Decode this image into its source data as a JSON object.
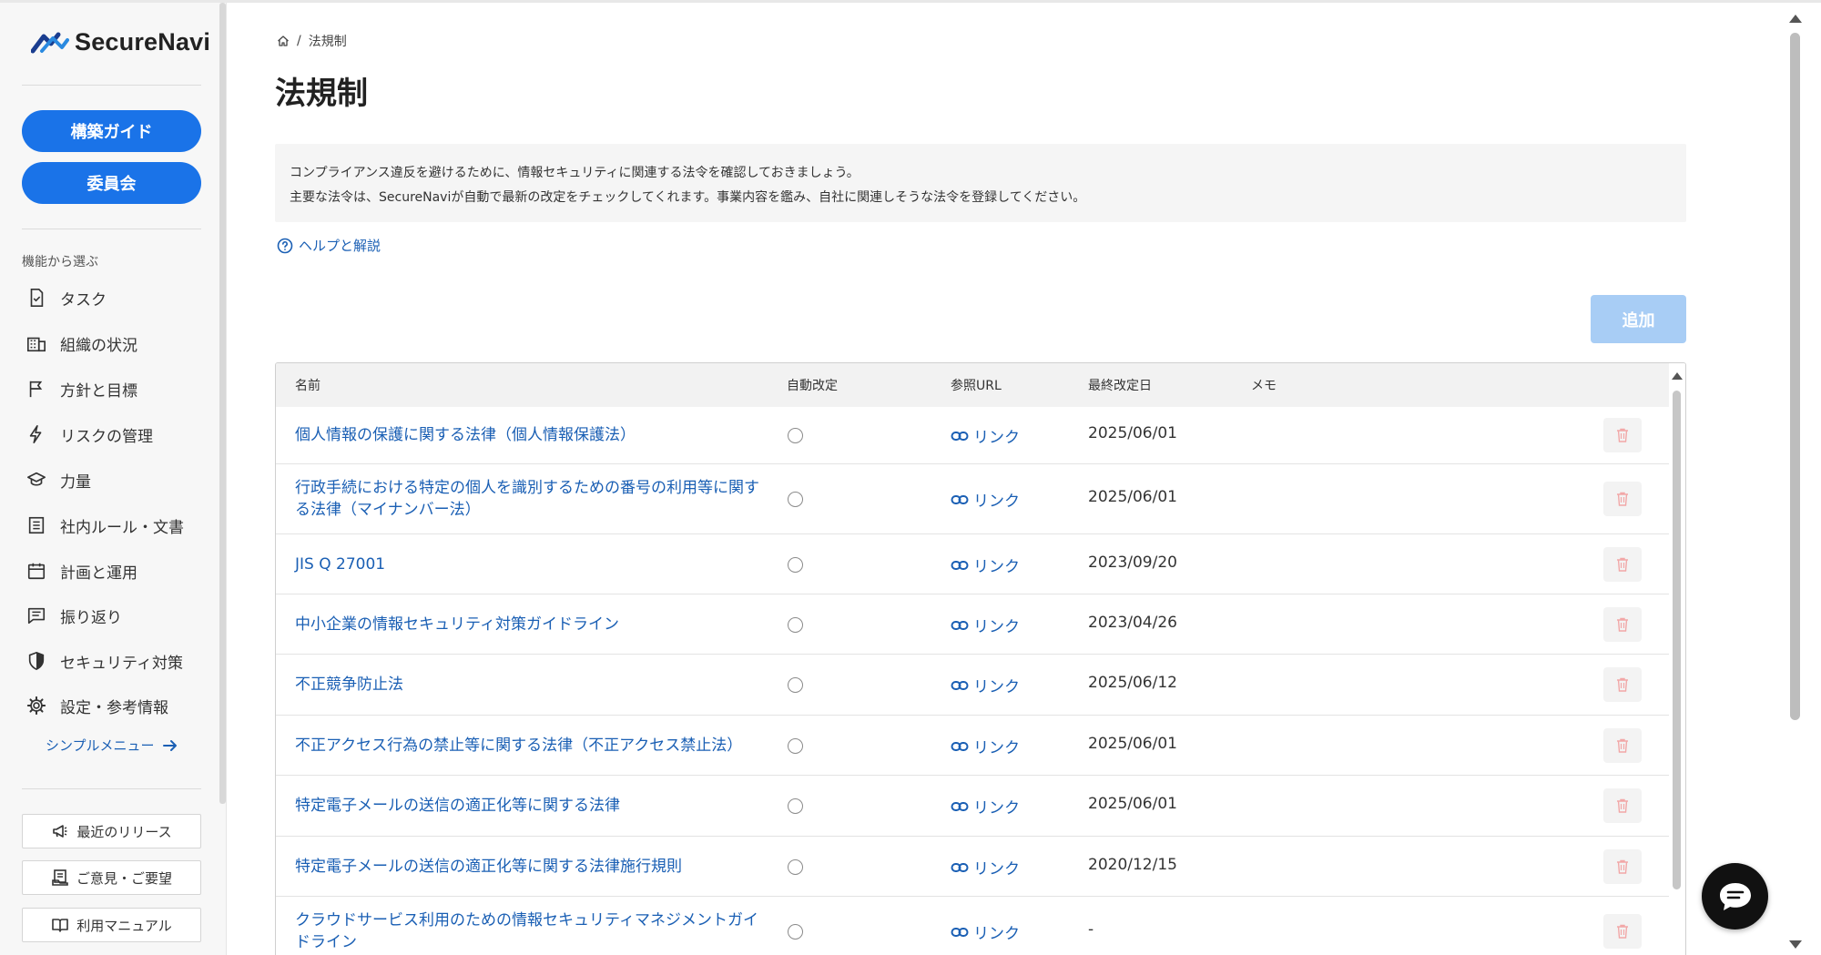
{
  "app": {
    "logo_text": "SecureNavi"
  },
  "sidebar": {
    "guide_button": "構築ガイド",
    "committee_button": "委員会",
    "section_label": "機能から選ぶ",
    "items": [
      {
        "label": "タスク",
        "icon": "task-check-icon"
      },
      {
        "label": "組織の状況",
        "icon": "building-icon"
      },
      {
        "label": "方針と目標",
        "icon": "flag-icon"
      },
      {
        "label": "リスクの管理",
        "icon": "bolt-icon"
      },
      {
        "label": "力量",
        "icon": "graduation-cap-icon"
      },
      {
        "label": "社内ルール・文書",
        "icon": "document-icon"
      },
      {
        "label": "計画と運用",
        "icon": "calendar-icon"
      },
      {
        "label": "振り返り",
        "icon": "notes-icon"
      },
      {
        "label": "セキュリティ対策",
        "icon": "shield-icon"
      },
      {
        "label": "設定・参考情報",
        "icon": "gear-icon"
      }
    ],
    "simple_menu": "シンプルメニュー",
    "footer": {
      "releases": "最近のリリース",
      "feedback": "ご意見・ご要望",
      "manual": "利用マニュアル"
    }
  },
  "breadcrumb": {
    "separator": "/",
    "current": "法規制"
  },
  "page": {
    "title": "法規制",
    "info_line1": "コンプライアンス違反を避けるために、情報セキュリティに関連する法令を確認しておきましょう。",
    "info_line2": "主要な法令は、SecureNaviが自動で最新の改定をチェックしてくれます。事業内容を鑑み、自社に関連しそうな法令を登録してください。",
    "help_link": "ヘルプと解説",
    "add_button": "追加"
  },
  "table": {
    "headers": {
      "name": "名前",
      "auto": "自動改定",
      "url": "参照URL",
      "date": "最終改定日",
      "memo": "メモ"
    },
    "link_label": "リンク",
    "rows": [
      {
        "name": "個人情報の保護に関する法律（個人情報保護法）",
        "date": "2025/06/01"
      },
      {
        "name": "行政手続における特定の個人を識別するための番号の利用等に関する法律（マイナンバー法）",
        "date": "2025/06/01"
      },
      {
        "name": "JIS Q 27001",
        "date": "2023/09/20"
      },
      {
        "name": "中小企業の情報セキュリティ対策ガイドライン",
        "date": "2023/04/26"
      },
      {
        "name": "不正競争防止法",
        "date": "2025/06/12"
      },
      {
        "name": "不正アクセス行為の禁止等に関する法律（不正アクセス禁止法）",
        "date": "2025/06/01"
      },
      {
        "name": "特定電子メールの送信の適正化等に関する法律",
        "date": "2025/06/01"
      },
      {
        "name": "特定電子メールの送信の適正化等に関する法律施行規則",
        "date": "2020/12/15"
      },
      {
        "name": "クラウドサービス利用のための情報セキュリティマネジメントガイドライン",
        "date": "-"
      }
    ]
  },
  "colors": {
    "primary": "#1a73e8",
    "link": "#1a5fb4",
    "disabled_primary": "#a8cdf5",
    "delete_icon": "#f2a7a7"
  }
}
